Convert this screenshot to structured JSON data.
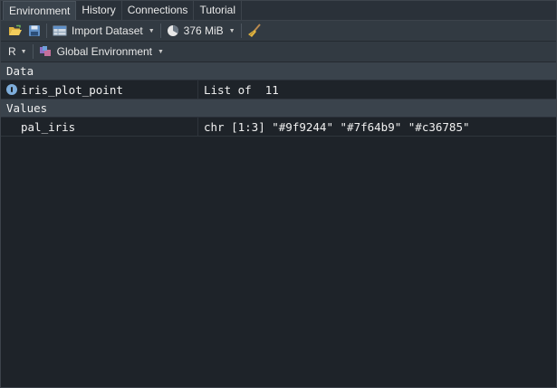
{
  "tabs": [
    {
      "label": "Environment",
      "active": true
    },
    {
      "label": "History",
      "active": false
    },
    {
      "label": "Connections",
      "active": false
    },
    {
      "label": "Tutorial",
      "active": false
    }
  ],
  "toolbar1": {
    "open_icon": "folder-open-icon",
    "save_icon": "save-icon",
    "import_label": "Import Dataset",
    "memory_label": "376 MiB",
    "clear_icon": "broom-icon"
  },
  "toolbar2": {
    "language": "R",
    "env_label": "Global Environment"
  },
  "sections": {
    "data": {
      "title": "Data",
      "rows": [
        {
          "name": "iris_plot_point",
          "value": "List of  11"
        }
      ]
    },
    "values": {
      "title": "Values",
      "rows": [
        {
          "name": "pal_iris",
          "value": "chr [1:3] \"#9f9244\" \"#7f64b9\" \"#c36785\""
        }
      ]
    }
  },
  "colors": {
    "background": "#1e2329",
    "toolbar": "#323a42",
    "section": "#3a434c",
    "accent": "#7faedb"
  }
}
